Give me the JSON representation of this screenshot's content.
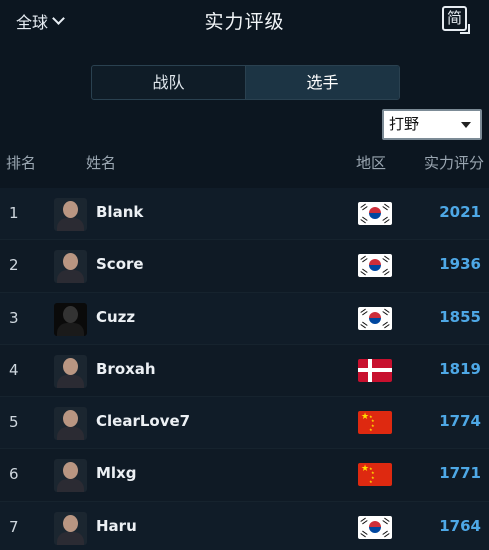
{
  "header": {
    "region_label": "全球",
    "title": "实力评级",
    "lang_toggle": "简"
  },
  "tabs": [
    {
      "label": "战队",
      "active": false
    },
    {
      "label": "选手",
      "active": true
    }
  ],
  "filter": {
    "selected": "打野"
  },
  "columns": {
    "rank": "排名",
    "name": "姓名",
    "region": "地区",
    "score": "实力评分"
  },
  "players": [
    {
      "rank": "1",
      "name": "Blank",
      "flag": "korea",
      "score": "2021"
    },
    {
      "rank": "2",
      "name": "Score",
      "flag": "korea",
      "score": "1936"
    },
    {
      "rank": "3",
      "name": "Cuzz",
      "flag": "korea",
      "score": "1855"
    },
    {
      "rank": "4",
      "name": "Broxah",
      "flag": "denmark",
      "score": "1819"
    },
    {
      "rank": "5",
      "name": "ClearLove7",
      "flag": "china",
      "score": "1774"
    },
    {
      "rank": "6",
      "name": "Mlxg",
      "flag": "china",
      "score": "1771"
    },
    {
      "rank": "7",
      "name": "Haru",
      "flag": "korea",
      "score": "1764"
    }
  ],
  "colors": {
    "background": "#0c1620",
    "score": "#4ea8e6",
    "active_tab": "#1c3444"
  }
}
